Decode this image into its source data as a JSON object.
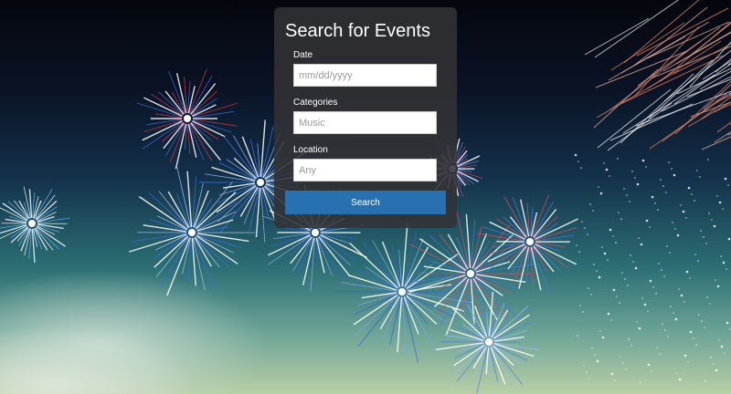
{
  "background": {
    "description_icon": "fireworks-night-sky-image"
  },
  "search_panel": {
    "title": "Search for Events",
    "fields": {
      "date": {
        "label": "Date",
        "placeholder": "mm/dd/yyyy",
        "value": ""
      },
      "categories": {
        "label": "Categories",
        "placeholder": "Music",
        "value": ""
      },
      "location": {
        "label": "Location",
        "placeholder": "Any",
        "value": ""
      }
    },
    "search_label": "Search"
  },
  "colors": {
    "accent": "#2771b0",
    "panel_bg": "#323234"
  }
}
